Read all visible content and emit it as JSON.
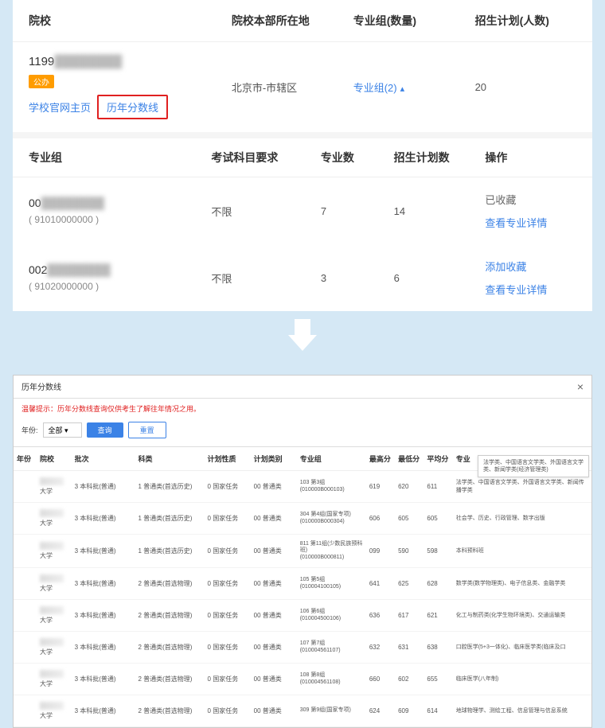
{
  "top": {
    "headers": [
      "院校",
      "院校本部所在地",
      "专业组(数量)",
      "招生计划(人数)"
    ],
    "school": {
      "code": "1199",
      "badge": "公办",
      "link1": "学校官网主页",
      "link2": "历年分数线",
      "location": "北京市-市辖区",
      "group_link": "专业组(2)",
      "plan_count": "20"
    },
    "sub_headers": [
      "专业组",
      "考试科目要求",
      "专业数",
      "招生计划数",
      "操作"
    ],
    "groups": [
      {
        "code": "00",
        "id": "( 91010000000 )",
        "requirement": "不限",
        "majors": "7",
        "plan": "14",
        "action1": "已收藏",
        "action1_link": false,
        "action2": "查看专业详情"
      },
      {
        "code": "002",
        "id": "( 91020000000 )",
        "requirement": "不限",
        "majors": "3",
        "plan": "6",
        "action1": "添加收藏",
        "action1_link": true,
        "action2": "查看专业详情"
      }
    ]
  },
  "bottom": {
    "title": "历年分数线",
    "warning": "温馨提示：历年分数线查询仅供考生了解往年情况之用。",
    "filter": {
      "year_label": "年份:",
      "year_value": "全部",
      "search_btn": "查询",
      "reset_btn": "重置"
    },
    "headers": [
      "年份",
      "院校",
      "批次",
      "科类",
      "计划性质",
      "计划类别",
      "专业组",
      "最高分",
      "最低分",
      "平均分",
      "专业"
    ],
    "rows": [
      {
        "school": "大学",
        "batch": "3 本科批(普通)",
        "subject": "1 普通类(首选历史)",
        "plan_nature": "0 国家任务",
        "plan_type": "00 普通类",
        "group": "103 第3组\n(010000B000103)",
        "max": "619",
        "min": "620",
        "avg": "611",
        "majors": "法学类、中国语言文学类、外国语言文学类、新闻传播学类"
      },
      {
        "school": "大学",
        "batch": "3 本科批(普通)",
        "subject": "1 普通类(首选历史)",
        "plan_nature": "0 国家任务",
        "plan_type": "00 普通类",
        "group": "304 第4组(国家专项)\n(010000B000304)",
        "max": "606",
        "min": "605",
        "avg": "605",
        "majors": "社会学、历史、行政管理、数字出版"
      },
      {
        "school": "大学",
        "batch": "3 本科批(普通)",
        "subject": "1 普通类(首选历史)",
        "plan_nature": "0 国家任务",
        "plan_type": "00 普通类",
        "group": "811 第11组(少数民族预科班)\n(010000B000811)",
        "max": "099",
        "min": "590",
        "avg": "598",
        "majors": "本科预科班"
      },
      {
        "school": "大学",
        "batch": "3 本科批(普通)",
        "subject": "2 普通类(首选物理)",
        "plan_nature": "0 国家任务",
        "plan_type": "00 普通类",
        "group": "105 第5组\n(010004100105)",
        "max": "641",
        "min": "625",
        "avg": "628",
        "majors": "数学类(数学物理类)、电子信息类、金融学类"
      },
      {
        "school": "大学",
        "batch": "3 本科批(普通)",
        "subject": "2 普通类(首选物理)",
        "plan_nature": "0 国家任务",
        "plan_type": "00 普通类",
        "group": "106 第6组\n(010004500106)",
        "max": "636",
        "min": "617",
        "avg": "621",
        "majors": "化工与制药类(化学生物环境类)、交通运输类"
      },
      {
        "school": "大学",
        "batch": "3 本科批(普通)",
        "subject": "2 普通类(首选物理)",
        "plan_nature": "0 国家任务",
        "plan_type": "00 普通类",
        "group": "107 第7组\n(010004561107)",
        "max": "632",
        "min": "631",
        "avg": "638",
        "majors": "口腔医学(5+3一体化)、临床医学类(临床及口"
      },
      {
        "school": "大学",
        "batch": "3 本科批(普通)",
        "subject": "2 普通类(首选物理)",
        "plan_nature": "0 国家任务",
        "plan_type": "00 普通类",
        "group": "108 第8组\n(010004561108)",
        "max": "660",
        "min": "602",
        "avg": "655",
        "majors": "临床医学(八年制)"
      },
      {
        "school": "大学",
        "batch": "3 本科批(普通)",
        "subject": "2 普通类(首选物理)",
        "plan_nature": "0 国家任务",
        "plan_type": "00 普通类",
        "group": "309 第9组(国家专项)",
        "max": "624",
        "min": "609",
        "avg": "614",
        "majors": "地球物理学、测绘工程、信息管理与信息系统"
      }
    ],
    "tooltip": "法学类、中国语言文学类、外国语言文学类、新闻学类(经济管理类)"
  }
}
